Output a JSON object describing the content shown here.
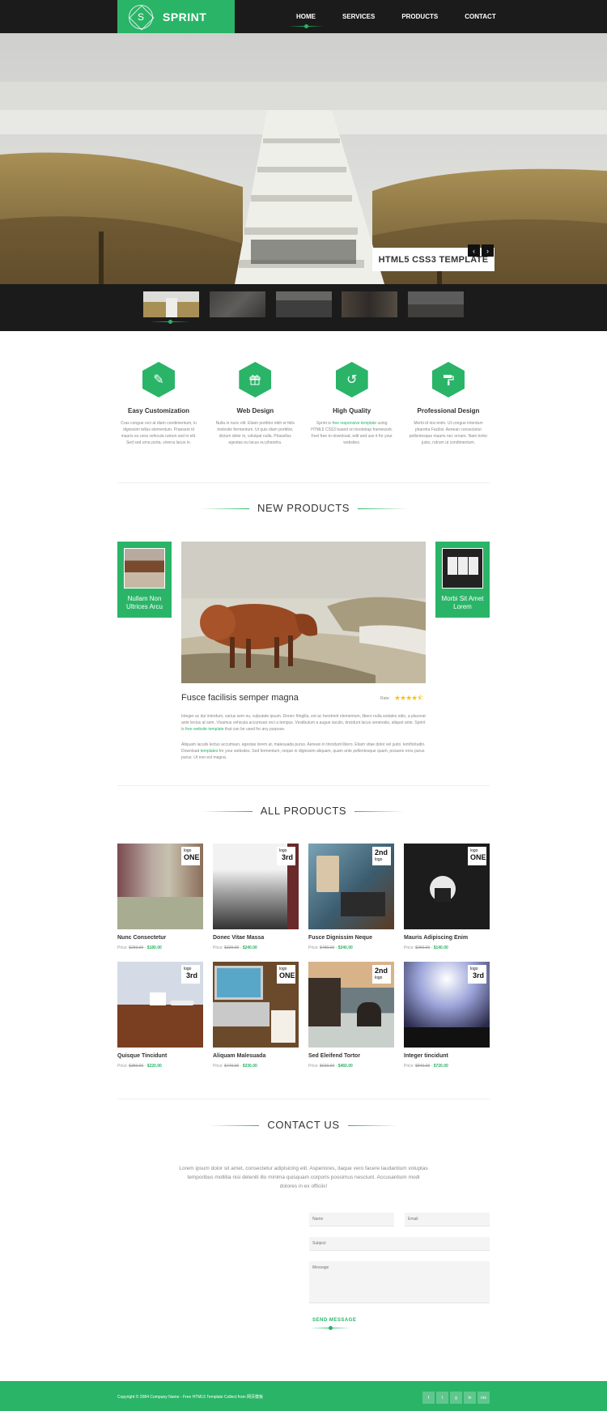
{
  "header": {
    "logo_letter": "S",
    "logo_text": "SPRINT",
    "nav": [
      "HOME",
      "SERVICES",
      "PRODUCTS",
      "CONTACT"
    ]
  },
  "hero": {
    "caption": "HTML5 CSS3 TEMPLATE",
    "prev": "‹",
    "next": "›"
  },
  "features": [
    {
      "icon": "pencil-icon",
      "title": "Easy Customization",
      "text": "Cras congue orci at diam condimentum, in dignissim tellus elementum. Praesent id mauris eu urna vehicula rutrum sed in elit. Sed sed urna porta, viverra lacus in."
    },
    {
      "icon": "gift-icon",
      "title": "Web Design",
      "text": "Nulla in nunc elit. Etiam porttitor nibh et felis molestie fermentum. Ut quis diam porttitor, dictum dolor in, volutpat nulla. Phasellus egestas eu lacus eu pharetra."
    },
    {
      "icon": "history-icon",
      "title": "High Quality",
      "text_before": "Sprint is ",
      "link": "free responsive template",
      "text_after": " using HTML5 CSS3 based on bootstrap framework. Feel free to download, edit and use it for your websites."
    },
    {
      "icon": "paint-roller-icon",
      "title": "Professional Design",
      "text": "Morbi id nisi enim. Ut congue interdum pharetra Facilisi. Aenean consectetur pellentesque mauris nec ornare. Nam tortor justo, rutrum ut condimentum."
    }
  ],
  "new_products": {
    "heading": "NEW PRODUCTS",
    "left_card": "Nullam Non Ultrices Arcu",
    "right_card": "Morbi Sit Amet Lorem",
    "title": "Fusce facilisis semper magna",
    "rate_label": "Rate:",
    "rating": 4.5,
    "p1_before": "Integer ac dui interdum, varius sem eu, vulputate ipsum. Donec fringilla, est ac hendrerit elementum, libero nulla sodales odio, a placerat ante lectus at sem. Vivamus vehicula accumsan orci a tempus. Vestibulum a augue iaculis, tincidunt lacus venenatis, aliquet ante. Sprint is ",
    "p1_link": "free website template",
    "p1_after": " that can be used for any purpose.",
    "p2_before": "Aliquam iaculis lectus accumsan, egestas lorem at, malesuada purus. Aenean in tincidunt libero. Etiam vitae dolor vel justo. lemfiicitudin. Download ",
    "p2_link": "templates",
    "p2_after": " for your websites. Sed fermentum, neque in dignissim aliquam, quam ante pellentesque quam, posuere eros purus purus. Ut non est magna."
  },
  "all_products": {
    "heading": "ALL PRODUCTS",
    "price_label": "Price:",
    "items": [
      {
        "name": "Nunc Consectetur",
        "old": "$260.00",
        "new": "$180.00",
        "badge_small": "logo",
        "badge_big": "ONE"
      },
      {
        "name": "Donec Vitae Massa",
        "old": "$320.00",
        "new": "$240.00",
        "badge_small": "logo",
        "badge_big": "3rd"
      },
      {
        "name": "Fusce Dignissim Neque",
        "old": "$480.00",
        "new": "$340.00",
        "badge_small": "logo",
        "badge_big": "2nd"
      },
      {
        "name": "Mauris Adipiscing Enim",
        "old": "$260.00",
        "new": "$140.00",
        "badge_small": "logo",
        "badge_big": "ONE"
      },
      {
        "name": "Quisque Tincidunt",
        "old": "$350.00",
        "new": "$220.00",
        "badge_small": "logo",
        "badge_big": "3rd"
      },
      {
        "name": "Aliquam Malesuada",
        "old": "$470.00",
        "new": "$330.00",
        "badge_small": "logo",
        "badge_big": "ONE"
      },
      {
        "name": "Sed Eleifend Tortor",
        "old": "$620.00",
        "new": "$460.00",
        "badge_small": "logo",
        "badge_big": "2nd"
      },
      {
        "name": "Integer tincidunt",
        "old": "$840.00",
        "new": "$720.00",
        "badge_small": "logo",
        "badge_big": "3rd"
      }
    ]
  },
  "contact": {
    "heading": "CONTACT US",
    "text": "Lorem ipsum dolor sit amet, consectetur adipisicing elit. Asperiores, itaque vero facere laudantium voluptas temporibus mollitia nisi deleniti illo minima quisquam corporis possimus nesciunt. Accusantium modi dolores in ex officiis!",
    "name_placeholder": "Name",
    "email_placeholder": "Email",
    "subject_placeholder": "Subject",
    "message_placeholder": "Message",
    "send": "SEND MESSAGE"
  },
  "footer": {
    "copyright": "Copyright © 2084 Company Name - Free HTML5 Template Collect from 网页模板",
    "social": [
      "f",
      "t",
      "g",
      "in",
      "rss"
    ]
  },
  "colors": {
    "accent": "#2ab467",
    "dark": "#1b1b1b",
    "star": "#f0c61e"
  }
}
